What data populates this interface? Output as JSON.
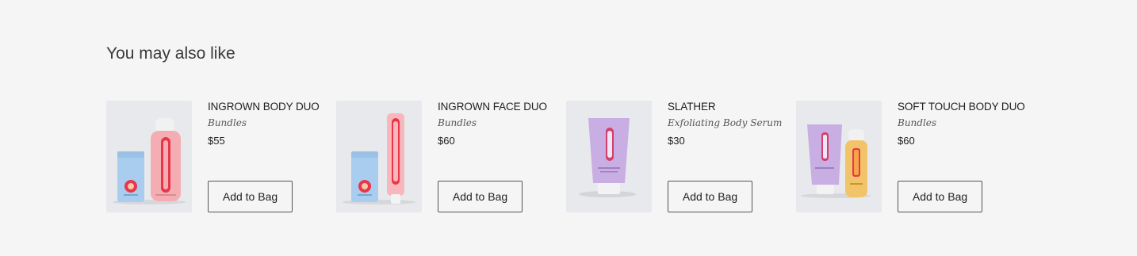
{
  "section": {
    "title": "You may also like"
  },
  "products": [
    {
      "name": "INGROWN BODY DUO",
      "category": "Bundles",
      "price": "$55",
      "button": "Add to Bag"
    },
    {
      "name": "INGROWN FACE DUO",
      "category": "Bundles",
      "price": "$60",
      "button": "Add to Bag"
    },
    {
      "name": "SLATHER",
      "category": "Exfoliating Body Serum",
      "price": "$30",
      "button": "Add to Bag"
    },
    {
      "name": "SOFT TOUCH BODY DUO",
      "category": "Bundles",
      "price": "$60",
      "button": "Add to Bag"
    }
  ],
  "images": [
    {
      "icon": "body-duo-product-image",
      "colors": [
        "#a9cdee",
        "#f4aeb3",
        "#e8364a"
      ]
    },
    {
      "icon": "face-duo-product-image",
      "colors": [
        "#a9cdee",
        "#f8b6bd",
        "#e8364a"
      ]
    },
    {
      "icon": "slather-tube-image",
      "colors": [
        "#c8aee2",
        "#d63d6a"
      ]
    },
    {
      "icon": "soft-touch-duo-image",
      "colors": [
        "#c8aee2",
        "#f2c46a",
        "#e8364a"
      ]
    }
  ]
}
